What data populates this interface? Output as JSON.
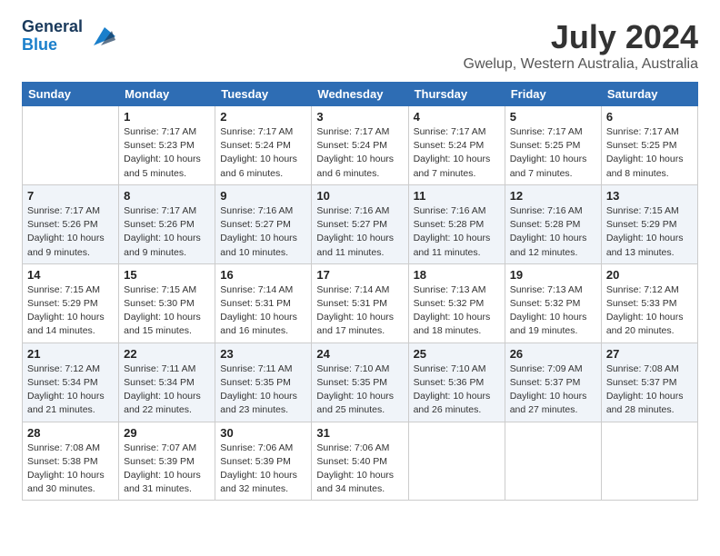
{
  "header": {
    "logo_line1": "General",
    "logo_line2": "Blue",
    "month": "July 2024",
    "location": "Gwelup, Western Australia, Australia"
  },
  "weekdays": [
    "Sunday",
    "Monday",
    "Tuesday",
    "Wednesday",
    "Thursday",
    "Friday",
    "Saturday"
  ],
  "weeks": [
    [
      {
        "day": "",
        "info": ""
      },
      {
        "day": "1",
        "info": "Sunrise: 7:17 AM\nSunset: 5:23 PM\nDaylight: 10 hours\nand 5 minutes."
      },
      {
        "day": "2",
        "info": "Sunrise: 7:17 AM\nSunset: 5:24 PM\nDaylight: 10 hours\nand 6 minutes."
      },
      {
        "day": "3",
        "info": "Sunrise: 7:17 AM\nSunset: 5:24 PM\nDaylight: 10 hours\nand 6 minutes."
      },
      {
        "day": "4",
        "info": "Sunrise: 7:17 AM\nSunset: 5:24 PM\nDaylight: 10 hours\nand 7 minutes."
      },
      {
        "day": "5",
        "info": "Sunrise: 7:17 AM\nSunset: 5:25 PM\nDaylight: 10 hours\nand 7 minutes."
      },
      {
        "day": "6",
        "info": "Sunrise: 7:17 AM\nSunset: 5:25 PM\nDaylight: 10 hours\nand 8 minutes."
      }
    ],
    [
      {
        "day": "7",
        "info": "Sunrise: 7:17 AM\nSunset: 5:26 PM\nDaylight: 10 hours\nand 9 minutes."
      },
      {
        "day": "8",
        "info": "Sunrise: 7:17 AM\nSunset: 5:26 PM\nDaylight: 10 hours\nand 9 minutes."
      },
      {
        "day": "9",
        "info": "Sunrise: 7:16 AM\nSunset: 5:27 PM\nDaylight: 10 hours\nand 10 minutes."
      },
      {
        "day": "10",
        "info": "Sunrise: 7:16 AM\nSunset: 5:27 PM\nDaylight: 10 hours\nand 11 minutes."
      },
      {
        "day": "11",
        "info": "Sunrise: 7:16 AM\nSunset: 5:28 PM\nDaylight: 10 hours\nand 11 minutes."
      },
      {
        "day": "12",
        "info": "Sunrise: 7:16 AM\nSunset: 5:28 PM\nDaylight: 10 hours\nand 12 minutes."
      },
      {
        "day": "13",
        "info": "Sunrise: 7:15 AM\nSunset: 5:29 PM\nDaylight: 10 hours\nand 13 minutes."
      }
    ],
    [
      {
        "day": "14",
        "info": "Sunrise: 7:15 AM\nSunset: 5:29 PM\nDaylight: 10 hours\nand 14 minutes."
      },
      {
        "day": "15",
        "info": "Sunrise: 7:15 AM\nSunset: 5:30 PM\nDaylight: 10 hours\nand 15 minutes."
      },
      {
        "day": "16",
        "info": "Sunrise: 7:14 AM\nSunset: 5:31 PM\nDaylight: 10 hours\nand 16 minutes."
      },
      {
        "day": "17",
        "info": "Sunrise: 7:14 AM\nSunset: 5:31 PM\nDaylight: 10 hours\nand 17 minutes."
      },
      {
        "day": "18",
        "info": "Sunrise: 7:13 AM\nSunset: 5:32 PM\nDaylight: 10 hours\nand 18 minutes."
      },
      {
        "day": "19",
        "info": "Sunrise: 7:13 AM\nSunset: 5:32 PM\nDaylight: 10 hours\nand 19 minutes."
      },
      {
        "day": "20",
        "info": "Sunrise: 7:12 AM\nSunset: 5:33 PM\nDaylight: 10 hours\nand 20 minutes."
      }
    ],
    [
      {
        "day": "21",
        "info": "Sunrise: 7:12 AM\nSunset: 5:34 PM\nDaylight: 10 hours\nand 21 minutes."
      },
      {
        "day": "22",
        "info": "Sunrise: 7:11 AM\nSunset: 5:34 PM\nDaylight: 10 hours\nand 22 minutes."
      },
      {
        "day": "23",
        "info": "Sunrise: 7:11 AM\nSunset: 5:35 PM\nDaylight: 10 hours\nand 23 minutes."
      },
      {
        "day": "24",
        "info": "Sunrise: 7:10 AM\nSunset: 5:35 PM\nDaylight: 10 hours\nand 25 minutes."
      },
      {
        "day": "25",
        "info": "Sunrise: 7:10 AM\nSunset: 5:36 PM\nDaylight: 10 hours\nand 26 minutes."
      },
      {
        "day": "26",
        "info": "Sunrise: 7:09 AM\nSunset: 5:37 PM\nDaylight: 10 hours\nand 27 minutes."
      },
      {
        "day": "27",
        "info": "Sunrise: 7:08 AM\nSunset: 5:37 PM\nDaylight: 10 hours\nand 28 minutes."
      }
    ],
    [
      {
        "day": "28",
        "info": "Sunrise: 7:08 AM\nSunset: 5:38 PM\nDaylight: 10 hours\nand 30 minutes."
      },
      {
        "day": "29",
        "info": "Sunrise: 7:07 AM\nSunset: 5:39 PM\nDaylight: 10 hours\nand 31 minutes."
      },
      {
        "day": "30",
        "info": "Sunrise: 7:06 AM\nSunset: 5:39 PM\nDaylight: 10 hours\nand 32 minutes."
      },
      {
        "day": "31",
        "info": "Sunrise: 7:06 AM\nSunset: 5:40 PM\nDaylight: 10 hours\nand 34 minutes."
      },
      {
        "day": "",
        "info": ""
      },
      {
        "day": "",
        "info": ""
      },
      {
        "day": "",
        "info": ""
      }
    ]
  ]
}
